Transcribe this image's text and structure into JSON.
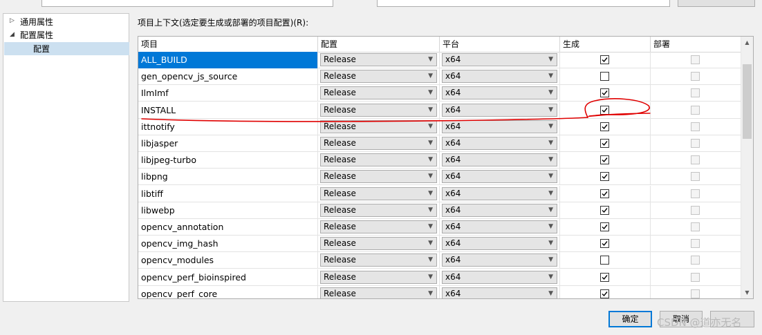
{
  "tree": {
    "items": [
      {
        "label": "通用属性",
        "expanded": false
      },
      {
        "label": "配置属性",
        "expanded": true
      },
      {
        "label": "配置",
        "selected": true
      }
    ]
  },
  "grid": {
    "label": "项目上下文(选定要生成或部署的项目配置)(R):",
    "headers": {
      "project": "项目",
      "config": "配置",
      "platform": "平台",
      "build": "生成",
      "deploy": "部署"
    },
    "rows": [
      {
        "name": "ALL_BUILD",
        "config": "Release",
        "platform": "x64",
        "build": true,
        "deploy": false
      },
      {
        "name": "gen_opencv_js_source",
        "config": "Release",
        "platform": "x64",
        "build": false,
        "deploy": false
      },
      {
        "name": "IlmImf",
        "config": "Release",
        "platform": "x64",
        "build": true,
        "deploy": false
      },
      {
        "name": "INSTALL",
        "config": "Release",
        "platform": "x64",
        "build": true,
        "deploy": false
      },
      {
        "name": "ittnotify",
        "config": "Release",
        "platform": "x64",
        "build": true,
        "deploy": false
      },
      {
        "name": "libjasper",
        "config": "Release",
        "platform": "x64",
        "build": true,
        "deploy": false
      },
      {
        "name": "libjpeg-turbo",
        "config": "Release",
        "platform": "x64",
        "build": true,
        "deploy": false
      },
      {
        "name": "libpng",
        "config": "Release",
        "platform": "x64",
        "build": true,
        "deploy": false
      },
      {
        "name": "libtiff",
        "config": "Release",
        "platform": "x64",
        "build": true,
        "deploy": false
      },
      {
        "name": "libwebp",
        "config": "Release",
        "platform": "x64",
        "build": true,
        "deploy": false
      },
      {
        "name": "opencv_annotation",
        "config": "Release",
        "platform": "x64",
        "build": true,
        "deploy": false
      },
      {
        "name": "opencv_img_hash",
        "config": "Release",
        "platform": "x64",
        "build": true,
        "deploy": false
      },
      {
        "name": "opencv_modules",
        "config": "Release",
        "platform": "x64",
        "build": false,
        "deploy": false
      },
      {
        "name": "opencv_perf_bioinspired",
        "config": "Release",
        "platform": "x64",
        "build": true,
        "deploy": false
      },
      {
        "name": "opencv_perf_core",
        "config": "Release",
        "platform": "x64",
        "build": true,
        "deploy": false
      }
    ],
    "selected_row": "ALL_BUILD"
  },
  "buttons": {
    "ok": "确定",
    "cancel": "取消"
  },
  "watermark": "CSDN @道亦无名",
  "colors": {
    "selection": "#0078d7",
    "annotation": "#e00000"
  }
}
